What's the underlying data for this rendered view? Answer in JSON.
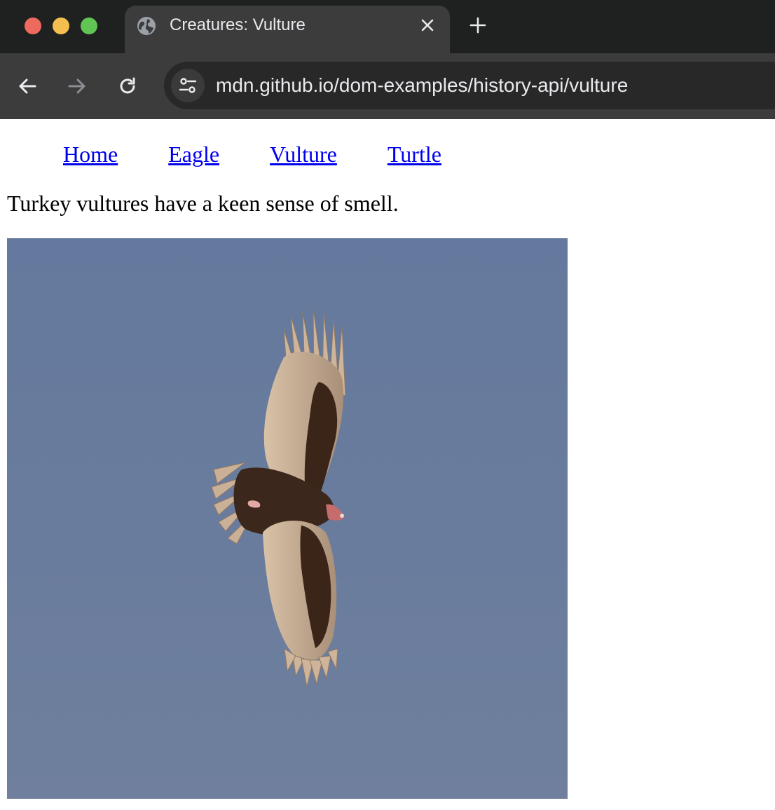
{
  "window": {
    "buttons": [
      "close",
      "minimize",
      "zoom"
    ]
  },
  "tab": {
    "title": "Creatures: Vulture",
    "favicon": "globe-icon",
    "close_icon": "close-icon"
  },
  "new_tab_icon": "plus-icon",
  "toolbar": {
    "back_icon": "arrow-left-icon",
    "forward_icon": "arrow-right-icon",
    "reload_icon": "reload-icon",
    "site_info_icon": "tune-icon",
    "url": "mdn.github.io/dom-examples/history-api/vulture"
  },
  "page": {
    "nav": [
      {
        "label": "Home"
      },
      {
        "label": "Eagle"
      },
      {
        "label": "Vulture"
      },
      {
        "label": "Turtle"
      }
    ],
    "description": "Turkey vultures have a keen sense of smell.",
    "image": {
      "subject": "turkey vulture in flight"
    }
  },
  "colors": {
    "tabstrip": "#1f2020",
    "toolbar": "#3c3c3c",
    "omnibox": "#282828",
    "link": "#0000ee",
    "sky": "#6a7fa3"
  }
}
